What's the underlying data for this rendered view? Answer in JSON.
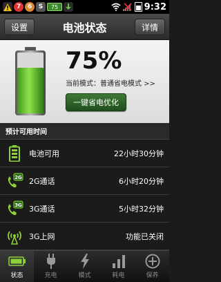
{
  "status_bar": {
    "badge_seven": "7",
    "badge_six": "6",
    "letter": "S",
    "battery_level": "75",
    "time": "9:32"
  },
  "titlebar": {
    "title": "电池状态",
    "left_button": "设置",
    "right_button": "详情"
  },
  "hero": {
    "percent": "75%",
    "mode_text": "当前模式：普通省电模式 >>",
    "optimize_button": "一键省电优化",
    "battery_fill": 0.75,
    "accent": "#5bbf2a"
  },
  "section": {
    "title": "预计可用时间"
  },
  "rows": [
    {
      "icon": "battery-icon",
      "label": "电池可用",
      "value": "22小时30分钟"
    },
    {
      "icon": "phone-2g-icon",
      "label": "2G通话",
      "value": "6小时20分钟"
    },
    {
      "icon": "phone-3g-icon",
      "label": "3G通话",
      "value": "5小时32分钟"
    },
    {
      "icon": "antenna-icon",
      "label": "3G上网",
      "value": "功能已关闭"
    }
  ],
  "nav": [
    {
      "icon": "battery-status-icon",
      "label": "状态",
      "active": true
    },
    {
      "icon": "plug-icon",
      "label": "充电",
      "active": false
    },
    {
      "icon": "lightning-icon",
      "label": "模式",
      "active": false
    },
    {
      "icon": "bar-chart-icon",
      "label": "耗电",
      "active": false
    },
    {
      "icon": "plus-circle-icon",
      "label": "保养",
      "active": false
    }
  ]
}
